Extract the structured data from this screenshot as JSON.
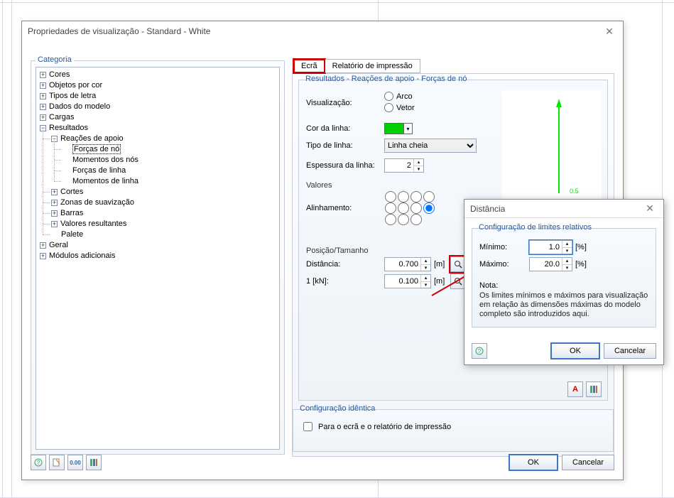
{
  "main_dialog": {
    "title": "Propriedades de visualização - Standard - White",
    "category_label": "Categoria",
    "ok": "OK",
    "cancel": "Cancelar"
  },
  "tree": {
    "items": [
      "Cores",
      "Objetos por cor",
      "Tipos de letra",
      "Dados do modelo",
      "Cargas",
      "Resultados",
      "Reações de apoio",
      "Forças de nó",
      "Momentos dos nós",
      "Forças de linha",
      "Momentos de linha",
      "Cortes",
      "Zonas de suavização",
      "Barras",
      "Valores resultantes",
      "Palete",
      "Geral",
      "Módulos adicionais"
    ]
  },
  "tabs": {
    "t1": "Ecrã",
    "t2": "Relatório de impressão"
  },
  "results": {
    "title": "Resultados - Reações de apoio - Forças de nó",
    "viz_label": "Visualização:",
    "viz_arc": "Arco",
    "viz_vetor": "Vetor",
    "color_label": "Cor da linha:",
    "type_label": "Tipo de linha:",
    "type_value": "Linha cheia",
    "thickness_label": "Espessura da linha:",
    "thickness_value": "2",
    "values_heading": "Valores",
    "align_label": "Alinhamento:",
    "pos_heading": "Posição/Tamanho",
    "dist_label": "Distância:",
    "dist_value": "0.700",
    "kn_label": "1 [kN]:",
    "kn_value": "0.100",
    "unit_m": "[m]",
    "preview_label": "0.5"
  },
  "same_config": {
    "title": "Configuração idêntica",
    "cb_label": "Para o ecrã e o relatório de impressão"
  },
  "sub_dialog": {
    "title": "Distância",
    "group_title": "Configuração de limites relativos",
    "min_label": "Mínimo:",
    "min_value": "1.0",
    "max_label": "Máximo:",
    "max_value": "20.0",
    "percent": "[%]",
    "note_h": "Nota:",
    "note_body": "Os limites mínimos e máximos para visualização em relação às dimensões máximas do modelo completo são introduzidos aqui.",
    "ok": "OK",
    "cancel": "Cancelar"
  }
}
